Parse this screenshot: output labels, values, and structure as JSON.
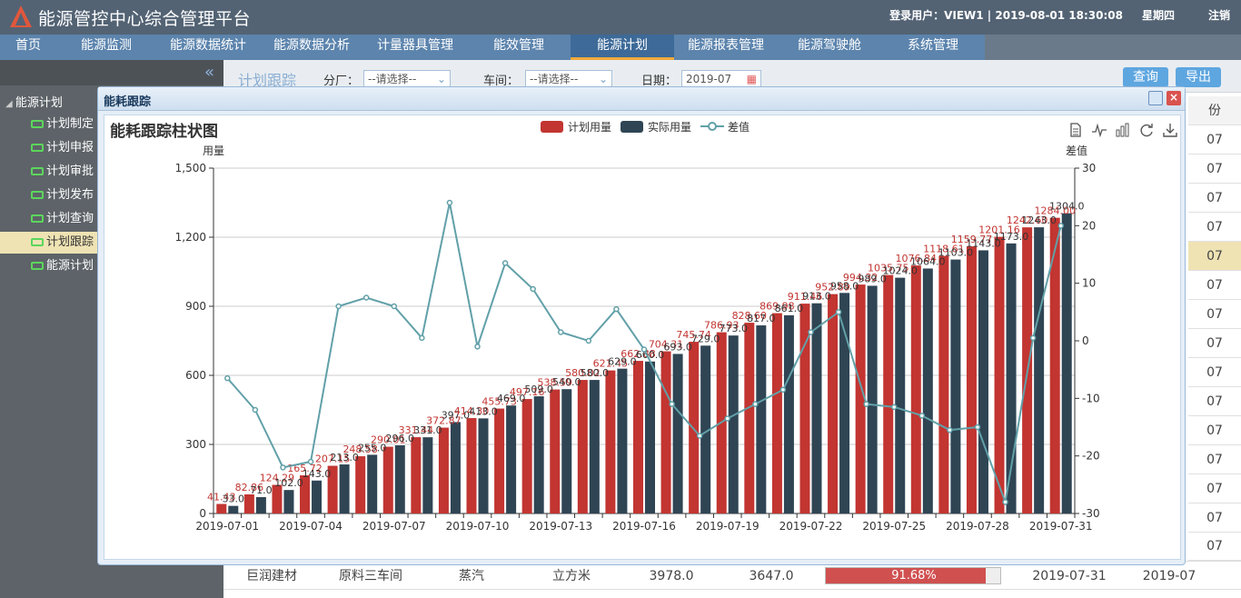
{
  "header": {
    "title": "能源管控中心综合管理平台",
    "user_info": "登录用户：VIEW1 | 2019-08-01  18:30:08",
    "weekday": "星期四",
    "logout": "注销"
  },
  "nav": [
    {
      "label": "首页"
    },
    {
      "label": "能源监测"
    },
    {
      "label": "能源数据统计"
    },
    {
      "label": "能源数据分析"
    },
    {
      "label": "计量器具管理"
    },
    {
      "label": "能效管理"
    },
    {
      "label": "能源计划"
    },
    {
      "label": "能源报表管理"
    },
    {
      "label": "能源驾驶舱"
    },
    {
      "label": "系统管理"
    }
  ],
  "sidebar": {
    "root": "能源计划",
    "items": [
      {
        "label": "计划制定"
      },
      {
        "label": "计划申报"
      },
      {
        "label": "计划审批"
      },
      {
        "label": "计划发布"
      },
      {
        "label": "计划查询"
      },
      {
        "label": "计划跟踪"
      },
      {
        "label": "能源计划"
      }
    ]
  },
  "toolbar": {
    "page_label": "计划跟踪",
    "factory_label": "分厂：",
    "factory_value": "--请选择--",
    "workshop_label": "车间：",
    "workshop_value": "--请选择--",
    "date_label": "日期：",
    "date_value": "2019-07",
    "query": "查询",
    "export": "导出"
  },
  "grid": {
    "header_partial": "份",
    "col_values": [
      "07",
      "07",
      "07",
      "07",
      "07",
      "07",
      "07",
      "07",
      "07",
      "07",
      "07",
      "07",
      "07",
      "07",
      "07"
    ],
    "bottom_row": {
      "factory": "巨润建材",
      "workshop": "原料三车间",
      "energy": "蒸汽",
      "unit": "立方米",
      "plan": "3978.0",
      "actual": "3647.0",
      "ratio_text": "91.68%",
      "ratio": 0.9168,
      "date": "2019-07-31",
      "month": "2019-07"
    }
  },
  "dialog": {
    "title": "能耗跟踪"
  },
  "chart_data": {
    "type": "bar",
    "title": "能耗跟踪柱状图",
    "ylabel": "用量",
    "y2label": "差值",
    "ylim": [
      0,
      1500
    ],
    "y2lim": [
      -30,
      30
    ],
    "yticks": [
      "0",
      "300",
      "600",
      "900",
      "1,200",
      "1,500"
    ],
    "y2ticks": [
      "-30",
      "-20",
      "-10",
      "0",
      "10",
      "20",
      "30"
    ],
    "legend_position": "top-center",
    "grid": true,
    "colors": {
      "plan": "#c23531",
      "actual": "#2f4554",
      "diff": "#61a0a8"
    },
    "categories": [
      "2019-07-01",
      "2019-07-02",
      "2019-07-03",
      "2019-07-04",
      "2019-07-05",
      "2019-07-06",
      "2019-07-07",
      "2019-07-08",
      "2019-07-09",
      "2019-07-10",
      "2019-07-11",
      "2019-07-12",
      "2019-07-13",
      "2019-07-14",
      "2019-07-15",
      "2019-07-16",
      "2019-07-17",
      "2019-07-18",
      "2019-07-19",
      "2019-07-20",
      "2019-07-21",
      "2019-07-22",
      "2019-07-23",
      "2019-07-24",
      "2019-07-25",
      "2019-07-26",
      "2019-07-27",
      "2019-07-28",
      "2019-07-29",
      "2019-07-30",
      "2019-07-31"
    ],
    "x_tick_labels": [
      "2019-07-01",
      "2019-07-04",
      "2019-07-07",
      "2019-07-10",
      "2019-07-13",
      "2019-07-16",
      "2019-07-19",
      "2019-07-22",
      "2019-07-25",
      "2019-07-28",
      "2019-07-31"
    ],
    "series": [
      {
        "name": "计划用量",
        "values": [
          41.43,
          82.86,
          124.29,
          165.72,
          207.15,
          248.58,
          290.01,
          331.44,
          372.87,
          414.3,
          455.73,
          497.16,
          538.59,
          580.02,
          621.45,
          662.88,
          704.31,
          745.74,
          787.17,
          828.6,
          870.03,
          911.46,
          952.89,
          994.32,
          1035.75,
          1077.18,
          1118.61,
          1160.04,
          1201.47,
          1242.9,
          1284.33
        ],
        "labels": [
          "41.43",
          "82.86",
          "124.29",
          "165.72",
          "207.15",
          "248.58",
          "290.01",
          "331.44",
          "372.87",
          "414.30",
          "455.73",
          "497.16",
          "538.59",
          "580.02",
          "621.45",
          "662.88",
          "704.31",
          "745.74",
          "786.93",
          "828.60",
          "869.98",
          "911.46",
          "952.89",
          "994.32",
          "1035.75",
          "1076.84",
          "1118.61",
          "1159.77",
          "1201.16",
          "1242.60",
          "1284.00"
        ]
      },
      {
        "name": "实际用量",
        "values": [
          33.0,
          71.0,
          102.0,
          143.0,
          213.0,
          255.0,
          296.0,
          331.0,
          397.0,
          413.0,
          469.0,
          509.0,
          540.0,
          580.0,
          629.0,
          660.0,
          693.0,
          729.0,
          773.0,
          817.0,
          861.0,
          913.0,
          958.0,
          989.0,
          1024.0,
          1064.0,
          1103.0,
          1143.0,
          1173.0,
          1243.0,
          1304.0
        ],
        "labels": [
          "33.0",
          "71.0",
          "102.0",
          "143.0",
          "213.0",
          "255.0",
          "296.0",
          "331.0",
          "397.0",
          "413.0",
          "469.0",
          "509.0",
          "540.0",
          "580.0",
          "629.0",
          "660.0",
          "693.0",
          "729.0",
          "773.0",
          "817.0",
          "861.0",
          "913.0",
          "958.0",
          "989.0",
          "1024.0",
          "1064.0",
          "1103.0",
          "1143.0",
          "1173.0",
          "1243.0",
          "1304.0"
        ]
      },
      {
        "name": "差值",
        "values": [
          -6.5,
          -12.0,
          -22.0,
          -21.0,
          6.0,
          7.5,
          6.0,
          0.5,
          24.0,
          -1.0,
          13.5,
          9.0,
          1.5,
          0.0,
          5.5,
          -1.5,
          -11.0,
          -16.5,
          -13.5,
          -11.0,
          -8.5,
          1.5,
          5.0,
          -11.0,
          -11.5,
          -13.0,
          -15.5,
          -15.0,
          -28.0,
          0.5,
          20.0
        ]
      }
    ]
  }
}
